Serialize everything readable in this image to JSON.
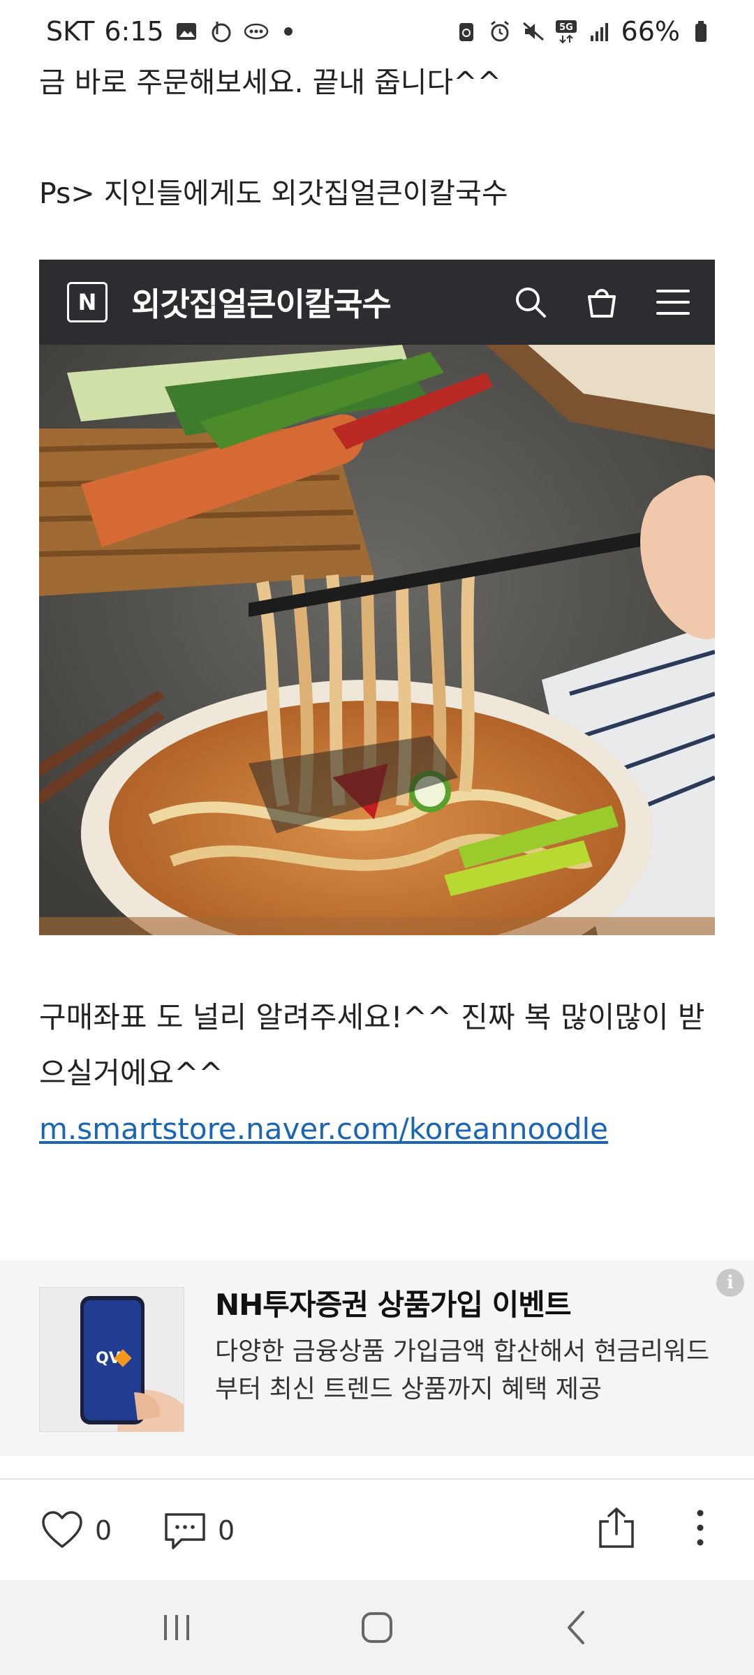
{
  "status_bar": {
    "carrier": "SKT",
    "time": "6:15",
    "network": "5G",
    "battery": "66%"
  },
  "post": {
    "line1": "금 바로 주문해보세요. 끝내 줍니다^^",
    "line2": "Ps> 지인들에게도 외갓집얼큰이칼국수"
  },
  "store_banner": {
    "logo_letter": "N",
    "store_name": "외갓집얼큰이칼국수",
    "icons": [
      "search-icon",
      "cart-icon",
      "menu-icon"
    ]
  },
  "caption": {
    "text": "구매좌표 도 널리 알려주세요!^^ 진짜 복 많이많이 받으실거에요^^",
    "link": " m.smartstore.naver.com/koreannoodle"
  },
  "ad": {
    "brand_badge": "QV",
    "title": "NH투자증권 상품가입 이벤트",
    "description": "다양한 금융상품 가입금액 합산해서 현금리워드부터 최신 트렌드 상품까지 혜택 제공",
    "info": "i"
  },
  "actions": {
    "likes": "0",
    "comments": "0"
  },
  "colors": {
    "link": "#1a66b5",
    "header_bg": "#2b2d30",
    "ad_bg": "#f4f5f7"
  }
}
